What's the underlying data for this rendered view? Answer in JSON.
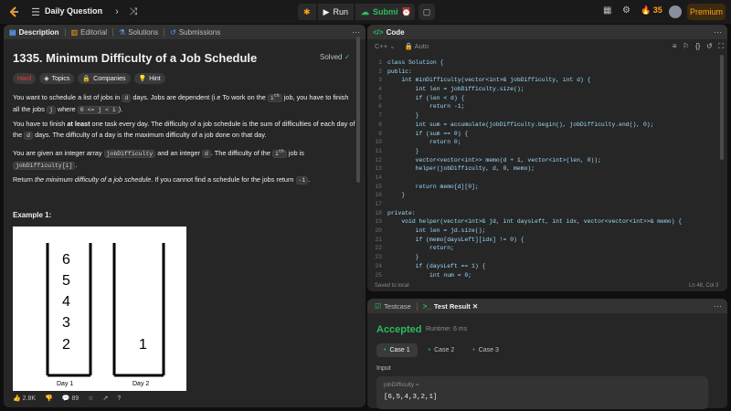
{
  "topbar": {
    "daily_label": "Daily Question",
    "run_label": "Run",
    "submit_label": "Submit",
    "streak": "35",
    "premium_label": "Premium"
  },
  "description_panel": {
    "tabs": [
      {
        "label": "Description",
        "icon": "doc-icon"
      },
      {
        "label": "Editorial",
        "icon": "book-icon"
      },
      {
        "label": "Solutions",
        "icon": "flask-icon"
      },
      {
        "label": "Submissions",
        "icon": "history-icon"
      }
    ],
    "title": "1335. Minimum Difficulty of a Job Schedule",
    "status": "Solved",
    "tags": [
      "Hard",
      "Topics",
      "Companies",
      "Hint"
    ],
    "p1a": "You want to schedule a list of jobs in ",
    "p1_d": "d",
    "p1b": " days. Jobs are dependent (i.e To work on the ",
    "p1_ith": "i",
    "p1_th": "th",
    "p1c": " job, you have to finish all the jobs ",
    "p1_j": "j",
    "p1d": " where ",
    "p1_cond": "0 <= j < i",
    "p1e": ").",
    "p2a": "You have to finish ",
    "p2_bold": "at least",
    "p2b": " one task every day. The difficulty of a job schedule is the sum of difficulties of each day of the ",
    "p2_d": "d",
    "p2c": " days. The difficulty of a day is the maximum difficulty of a job done on that day.",
    "p3a": "You are given an integer array ",
    "p3_arr": "jobDifficulty",
    "p3b": " and an integer ",
    "p3_d": "d",
    "p3c": ". The difficulty of the ",
    "p3_i": "i",
    "p3_th": "th",
    "p3d": " job is ",
    "p3_expr": "jobDifficulty[i]",
    "p3e": ".",
    "p4a": "Return ",
    "p4_em": "the minimum difficulty of a job schedule",
    "p4b": ". If you cannot find a schedule for the jobs return ",
    "p4_neg": "-1",
    "p4c": ".",
    "example_label": "Example 1:",
    "figure": {
      "day1_values": [
        "6",
        "5",
        "4",
        "3",
        "2"
      ],
      "day2_values": [
        "1"
      ],
      "day1_label": "Day 1",
      "day2_label": "Day 2"
    },
    "likes": "2.8K",
    "comments": "89"
  },
  "code_panel": {
    "title": "Code",
    "language": "C++",
    "mode": "Auto",
    "lines": [
      {
        "n": "1",
        "t": "class Solution {"
      },
      {
        "n": "2",
        "t": "public:"
      },
      {
        "n": "3",
        "t": "    int minDifficulty(vector<int>& jobDifficulty, int d) {"
      },
      {
        "n": "4",
        "t": "        int len = jobDifficulty.size();"
      },
      {
        "n": "5",
        "t": "        if (len < d) {"
      },
      {
        "n": "6",
        "t": "            return -1;"
      },
      {
        "n": "7",
        "t": "        }"
      },
      {
        "n": "8",
        "t": "        int sum = accumulate(jobDifficulty.begin(), jobDifficulty.end(), 0);"
      },
      {
        "n": "9",
        "t": "        if (sum == 0) {"
      },
      {
        "n": "10",
        "t": "            return 0;"
      },
      {
        "n": "11",
        "t": "        }"
      },
      {
        "n": "12",
        "t": "        vector<vector<int>> memo(d + 1, vector<int>(len, 0));"
      },
      {
        "n": "13",
        "t": "        helper(jobDifficulty, d, 0, memo);"
      },
      {
        "n": "14",
        "t": ""
      },
      {
        "n": "15",
        "t": "        return memo[d][0];"
      },
      {
        "n": "16",
        "t": "    }"
      },
      {
        "n": "17",
        "t": ""
      },
      {
        "n": "18",
        "t": "private:"
      },
      {
        "n": "19",
        "t": "    void helper(vector<int>& jd, int daysLeft, int idx, vector<vector<int>>& memo) {"
      },
      {
        "n": "20",
        "t": "        int len = jd.size();"
      },
      {
        "n": "21",
        "t": "        if (memo[daysLeft][idx] != 0) {"
      },
      {
        "n": "22",
        "t": "            return;"
      },
      {
        "n": "23",
        "t": "        }"
      },
      {
        "n": "24",
        "t": "        if (daysLeft == 1) {"
      },
      {
        "n": "25",
        "t": "            int num = 0;"
      }
    ],
    "saved_label": "Saved to local",
    "cursor_pos": "Ln 48, Col 3"
  },
  "result_panel": {
    "tabs": [
      {
        "label": "Testcase",
        "icon": "check-box-icon"
      },
      {
        "label": "Test Result",
        "icon": "terminal-icon"
      }
    ],
    "status": "Accepted",
    "runtime": "Runtime: 6 ms",
    "cases": [
      "Case 1",
      "Case 2",
      "Case 3"
    ],
    "input_label": "Input",
    "input_name": "jobDifficulty =",
    "input_value": "[6,5,4,3,2,1]"
  }
}
